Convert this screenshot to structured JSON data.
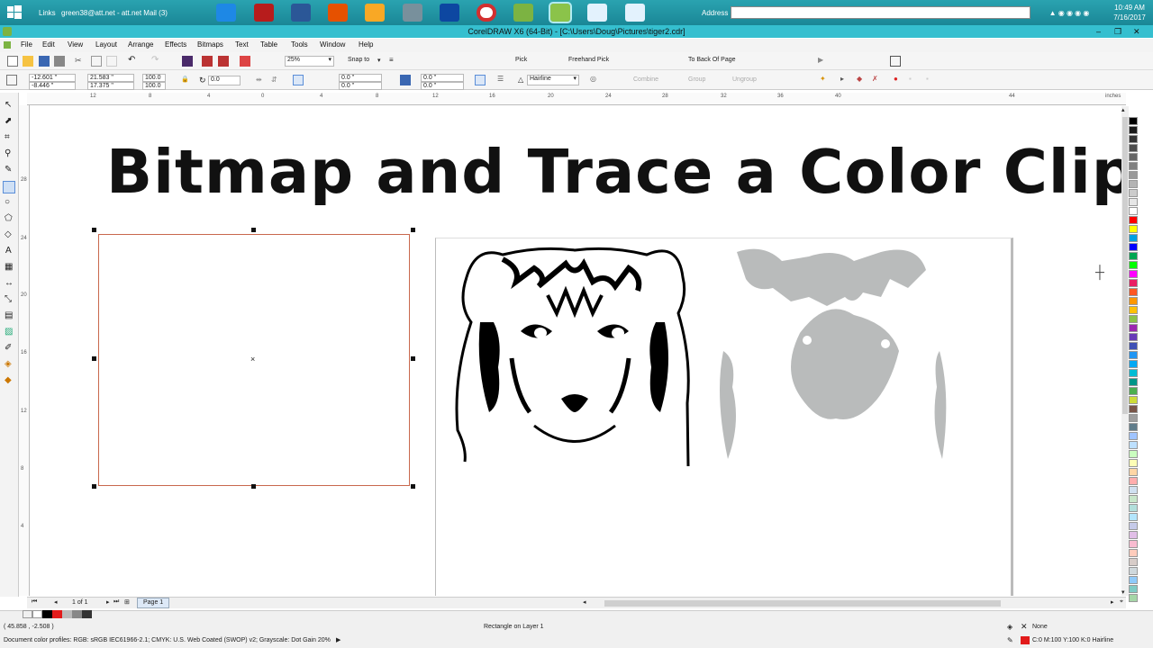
{
  "taskbar": {
    "links_label": "Links",
    "mail_label": "green38@att.net - att.net Mail (3)",
    "address_label": "Address",
    "time": "10:49 AM",
    "date": "7/16/2017"
  },
  "window": {
    "title": "CorelDRAW X6 (64-Bit) - [C:\\Users\\Doug\\Pictures\\tiger2.cdr]"
  },
  "menu": [
    "File",
    "Edit",
    "View",
    "Layout",
    "Arrange",
    "Effects",
    "Bitmaps",
    "Text",
    "Table",
    "Tools",
    "Window",
    "Help"
  ],
  "toolbar1": {
    "zoom": "25%",
    "snap_to": "Snap to",
    "pick_label": "Pick",
    "freehand_pick_label": "Freehand Pick",
    "to_back_label": "To Back Of Page"
  },
  "toolbar2": {
    "x": "-12.601 \"",
    "y": "-8.446 \"",
    "w": "21.583 \"",
    "h": "17.375 \"",
    "scale_x": "100.0",
    "scale_y": "100.0",
    "angle": "0.0",
    "pos_x": "0.0 \"",
    "pos_y": "0.0 \"",
    "pos_x2": "0.0 \"",
    "pos_y2": "0.0 \"",
    "outline": "Hairline",
    "combine": "Combine",
    "group": "Group",
    "ungroup": "Ungroup"
  },
  "ruler": {
    "unit": "inches",
    "ticks": [
      "12",
      "8",
      "4",
      "0",
      "4",
      "8",
      "12",
      "16",
      "20",
      "24",
      "28",
      "32",
      "36",
      "40",
      "44"
    ]
  },
  "ruler_v": {
    "ticks": [
      "28",
      "24",
      "20",
      "16",
      "12",
      "8",
      "4"
    ]
  },
  "canvas": {
    "heading": "Bitmap and Trace a Color Clipar"
  },
  "pages": {
    "counter": "1 of 1",
    "tab": "Page 1"
  },
  "status": {
    "coords": "( 45.858 , -2.508 )",
    "object": "Rectangle on Layer 1",
    "color_profiles": "Document color profiles: RGB: sRGB IEC61966-2.1; CMYK: U.S. Web Coated (SWOP) v2; Grayscale: Dot Gain 20%",
    "fill": "None",
    "outline": "C:0 M:100 Y:100 K:0  Hairline"
  },
  "palette_colors": [
    "#000000",
    "#1a1a1a",
    "#333333",
    "#4d4d4d",
    "#666666",
    "#808080",
    "#999999",
    "#b3b3b3",
    "#cccccc",
    "#e6e6e6",
    "#ffffff",
    "#ff0000",
    "#ffff00",
    "#00a0e0",
    "#0000ff",
    "#00a651",
    "#00ff00",
    "#ff00ff",
    "#e91e63",
    "#ff5722",
    "#ff9800",
    "#ffc107",
    "#8bc34a",
    "#9c27b0",
    "#673ab7",
    "#3f51b5",
    "#2196f3",
    "#03a9f4",
    "#00bcd4",
    "#009688",
    "#4caf50",
    "#cddc39",
    "#795548",
    "#9e9e9e",
    "#607d8b",
    "#a0c4ff",
    "#bde0fe",
    "#caffbf",
    "#fdffb6",
    "#ffd6a5",
    "#ffadad",
    "#d0e0f0",
    "#c8e6c9",
    "#b2dfdb",
    "#b3e5fc",
    "#c5cae9",
    "#e1bee7",
    "#f8bbd0",
    "#ffccbc",
    "#d7ccc8",
    "#cfd8dc",
    "#90caf9",
    "#80cbc4",
    "#a5d6a7"
  ]
}
